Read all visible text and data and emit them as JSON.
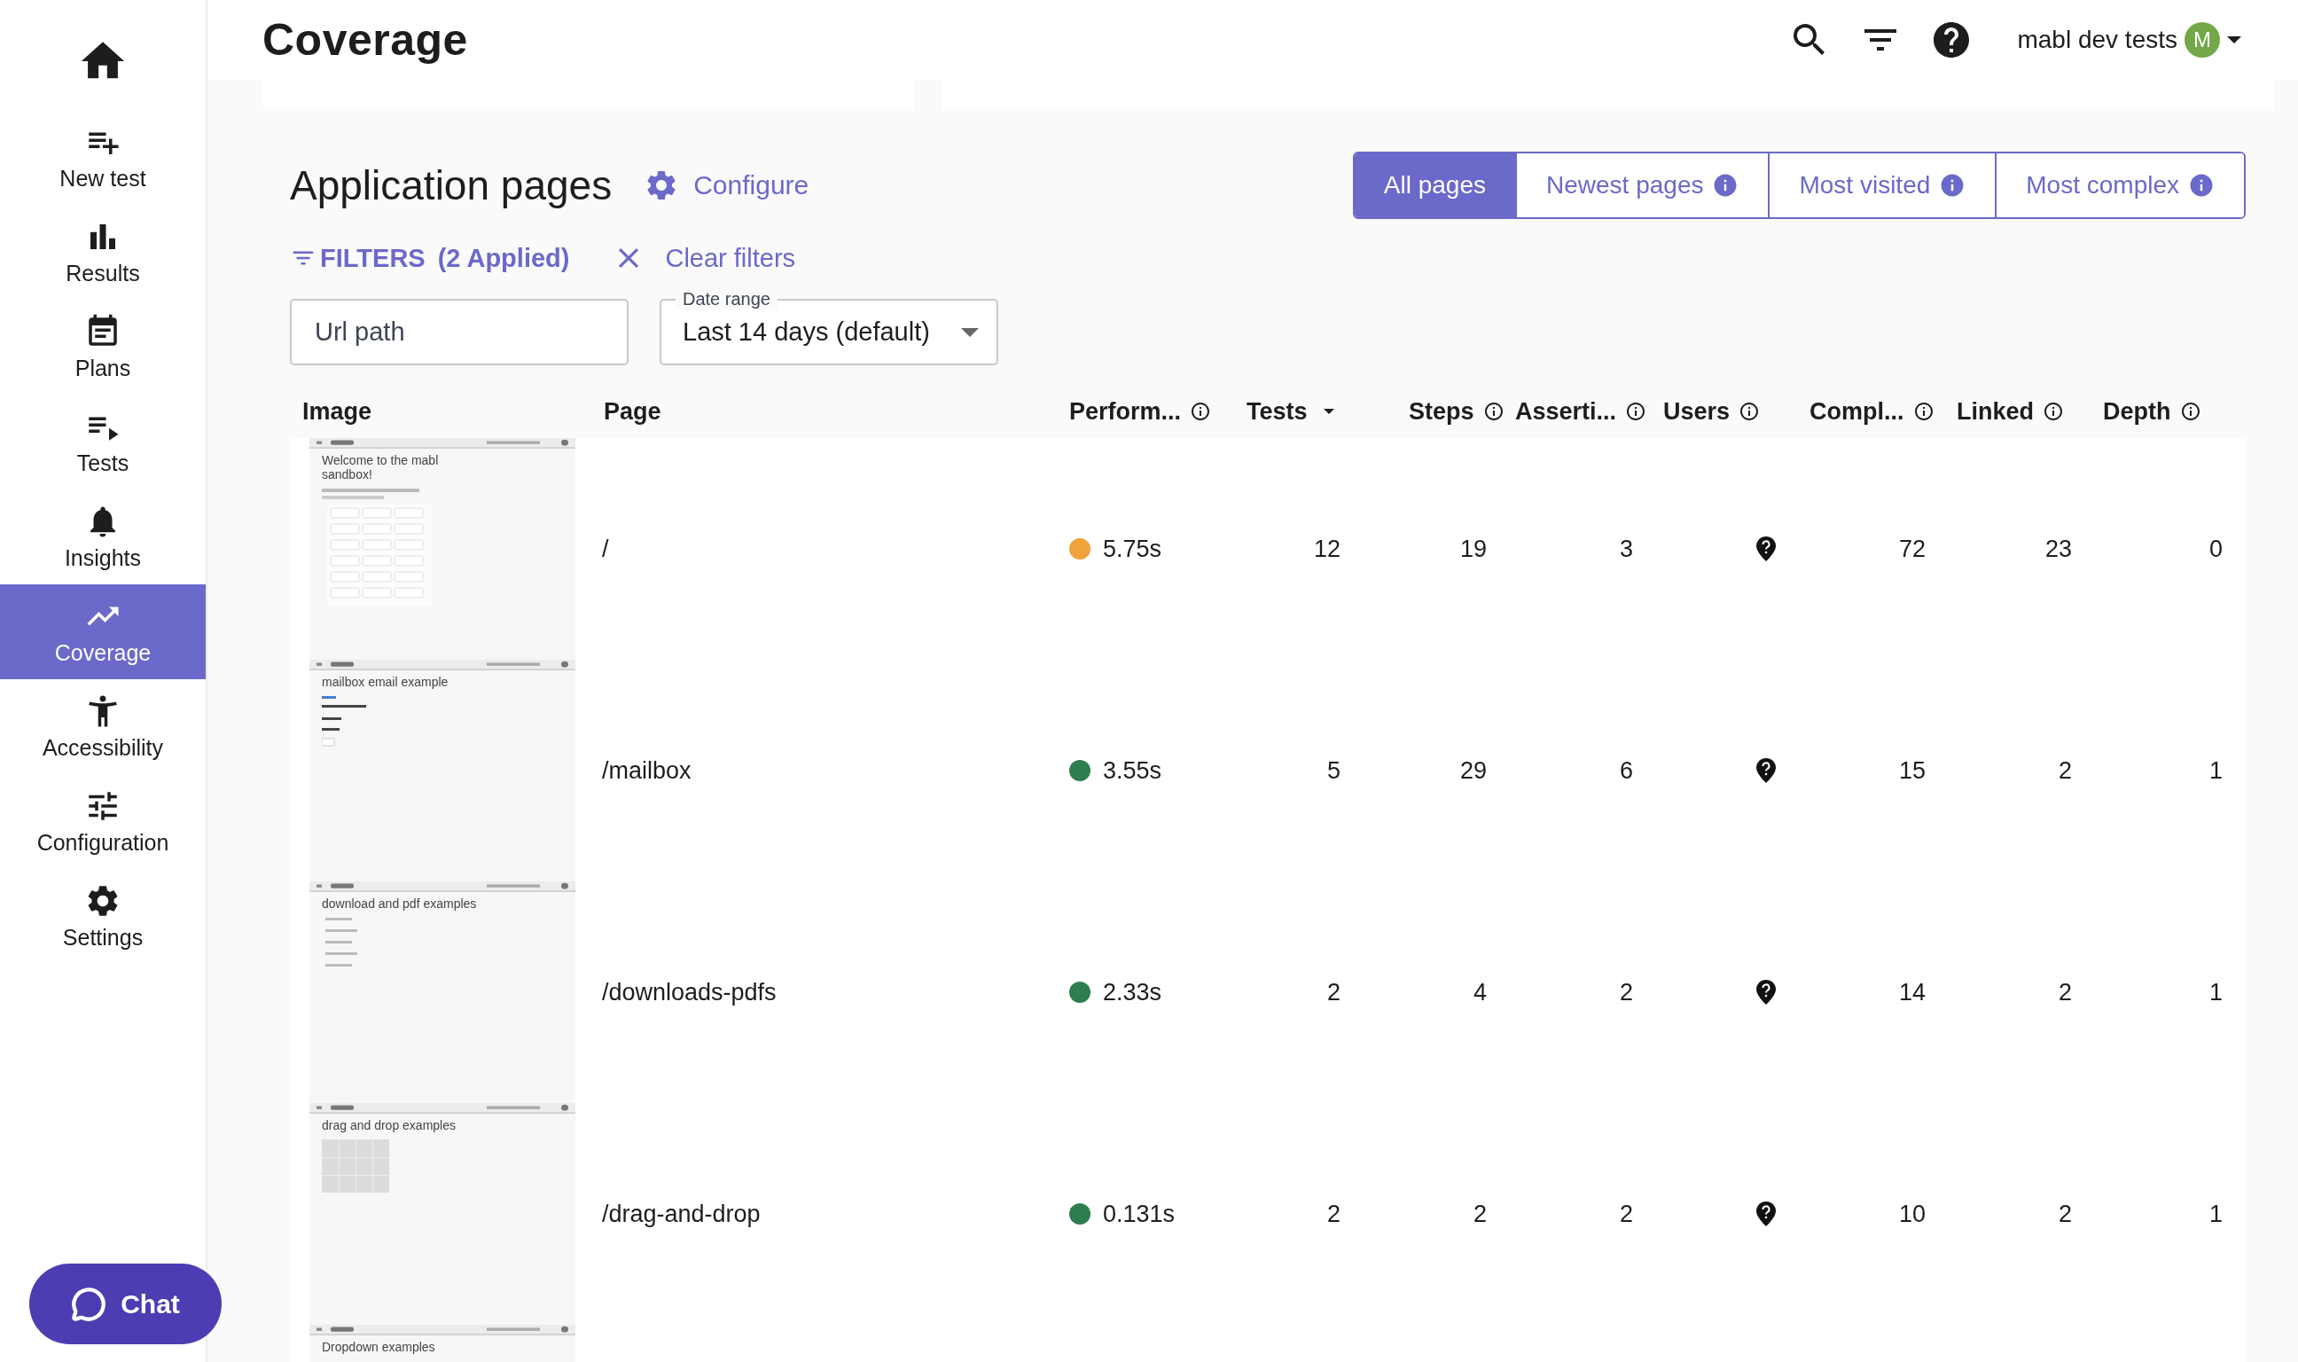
{
  "header": {
    "title": "Coverage",
    "account": "mabl dev tests",
    "avatar": "M"
  },
  "sidebar": {
    "items": [
      {
        "label": "New test",
        "selected": false
      },
      {
        "label": "Results",
        "selected": false
      },
      {
        "label": "Plans",
        "selected": false
      },
      {
        "label": "Tests",
        "selected": false
      },
      {
        "label": "Insights",
        "selected": false
      },
      {
        "label": "Coverage",
        "selected": true
      },
      {
        "label": "Accessibility",
        "selected": false
      },
      {
        "label": "Configuration",
        "selected": false
      },
      {
        "label": "Settings",
        "selected": false
      }
    ]
  },
  "section": {
    "title": "Application pages",
    "configure": "Configure"
  },
  "tabs": [
    {
      "label": "All pages",
      "info": false,
      "selected": true
    },
    {
      "label": "Newest pages",
      "info": true,
      "selected": false
    },
    {
      "label": "Most visited",
      "info": true,
      "selected": false
    },
    {
      "label": "Most complex",
      "info": true,
      "selected": false
    }
  ],
  "filters": {
    "label": "FILTERS",
    "applied": "(2 Applied)",
    "clear": "Clear filters"
  },
  "url_field": {
    "placeholder": "Url path"
  },
  "date_range": {
    "label": "Date range",
    "value": "Last 14 days (default)"
  },
  "table": {
    "columns": [
      {
        "label": "Image",
        "info": false,
        "sorted": false
      },
      {
        "label": "Page",
        "info": false,
        "sorted": false
      },
      {
        "label": "Perform...",
        "info": true,
        "sorted": false
      },
      {
        "label": "Tests",
        "info": false,
        "sorted": true
      },
      {
        "label": "Steps",
        "info": true,
        "sorted": false
      },
      {
        "label": "Asserti...",
        "info": true,
        "sorted": false
      },
      {
        "label": "Users",
        "info": true,
        "sorted": false
      },
      {
        "label": "Compl...",
        "info": true,
        "sorted": false
      },
      {
        "label": "Linked",
        "info": true,
        "sorted": false
      },
      {
        "label": "Depth",
        "info": true,
        "sorted": false
      }
    ],
    "rows": [
      {
        "thumbnail": {
          "kind": "buttons",
          "heading": "Welcome to the mabl sandbox!"
        },
        "page": "/",
        "performance": {
          "color": "#f0a23b",
          "time": "5.75s"
        },
        "counts": [
          "12",
          "19",
          "3"
        ],
        "metrics": [
          "72",
          "23",
          "0"
        ]
      },
      {
        "thumbnail": {
          "kind": "form",
          "heading": "mailbox email example"
        },
        "page": "/mailbox",
        "performance": {
          "color": "#2e7d4f",
          "time": "3.55s"
        },
        "counts": [
          "5",
          "29",
          "6"
        ],
        "metrics": [
          "15",
          "2",
          "1"
        ]
      },
      {
        "thumbnail": {
          "kind": "list",
          "heading": "download and pdf examples"
        },
        "page": "/downloads-pdfs",
        "performance": {
          "color": "#2e7d4f",
          "time": "2.33s"
        },
        "counts": [
          "2",
          "4",
          "2"
        ],
        "metrics": [
          "14",
          "2",
          "1"
        ]
      },
      {
        "thumbnail": {
          "kind": "grid",
          "heading": "drag and drop examples"
        },
        "page": "/drag-and-drop",
        "performance": {
          "color": "#2e7d4f",
          "time": "0.131s"
        },
        "counts": [
          "2",
          "2",
          "2"
        ],
        "metrics": [
          "10",
          "2",
          "1"
        ]
      }
    ],
    "partial_row": {
      "thumbnail": {
        "heading": "Dropdown examples"
      }
    }
  },
  "chat": {
    "label": "Chat"
  }
}
